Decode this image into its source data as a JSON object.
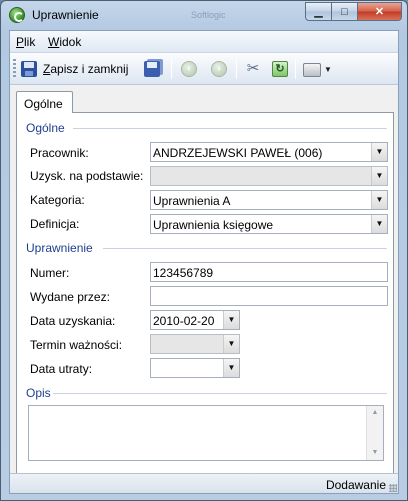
{
  "window": {
    "title": "Uprawnienie",
    "ghost_title": "Softlogic"
  },
  "menu": [
    {
      "ul": "P",
      "rest": "lik"
    },
    {
      "ul": "W",
      "rest": "idok"
    }
  ],
  "toolbar": {
    "save_close": {
      "ul": "Z",
      "rest": "apisz i zamknij"
    },
    "icons": [
      "save-close-icon",
      "save-icon",
      "back-icon",
      "forward-icon",
      "tools-icon",
      "refresh-icon",
      "print-icon"
    ]
  },
  "tabs": [
    "Ogólne"
  ],
  "general": {
    "title": "Ogólne",
    "employee": {
      "label": "Pracownik:",
      "value": "ANDRZEJEWSKI PAWEŁ (006)"
    },
    "based_on": {
      "label": "Uzysk. na podstawie:",
      "value": ""
    },
    "category": {
      "label": "Kategoria:",
      "value": "Uprawnienia A"
    },
    "definition": {
      "label": "Definicja:",
      "value": "Uprawnienia księgowe"
    }
  },
  "permission": {
    "title": "Uprawnienie",
    "number": {
      "label": "Numer:",
      "value": "123456789"
    },
    "issued_by": {
      "label": "Wydane przez:",
      "value": ""
    },
    "obtained_date": {
      "label": "Data uzyskania:",
      "value": "2010-02-20"
    },
    "valid_until": {
      "label": "Termin ważności:",
      "value": ""
    },
    "lost_date": {
      "label": "Data utraty:",
      "value": ""
    }
  },
  "description": {
    "title": "Opis",
    "value": ""
  },
  "status": {
    "mode": "Dodawanie"
  }
}
